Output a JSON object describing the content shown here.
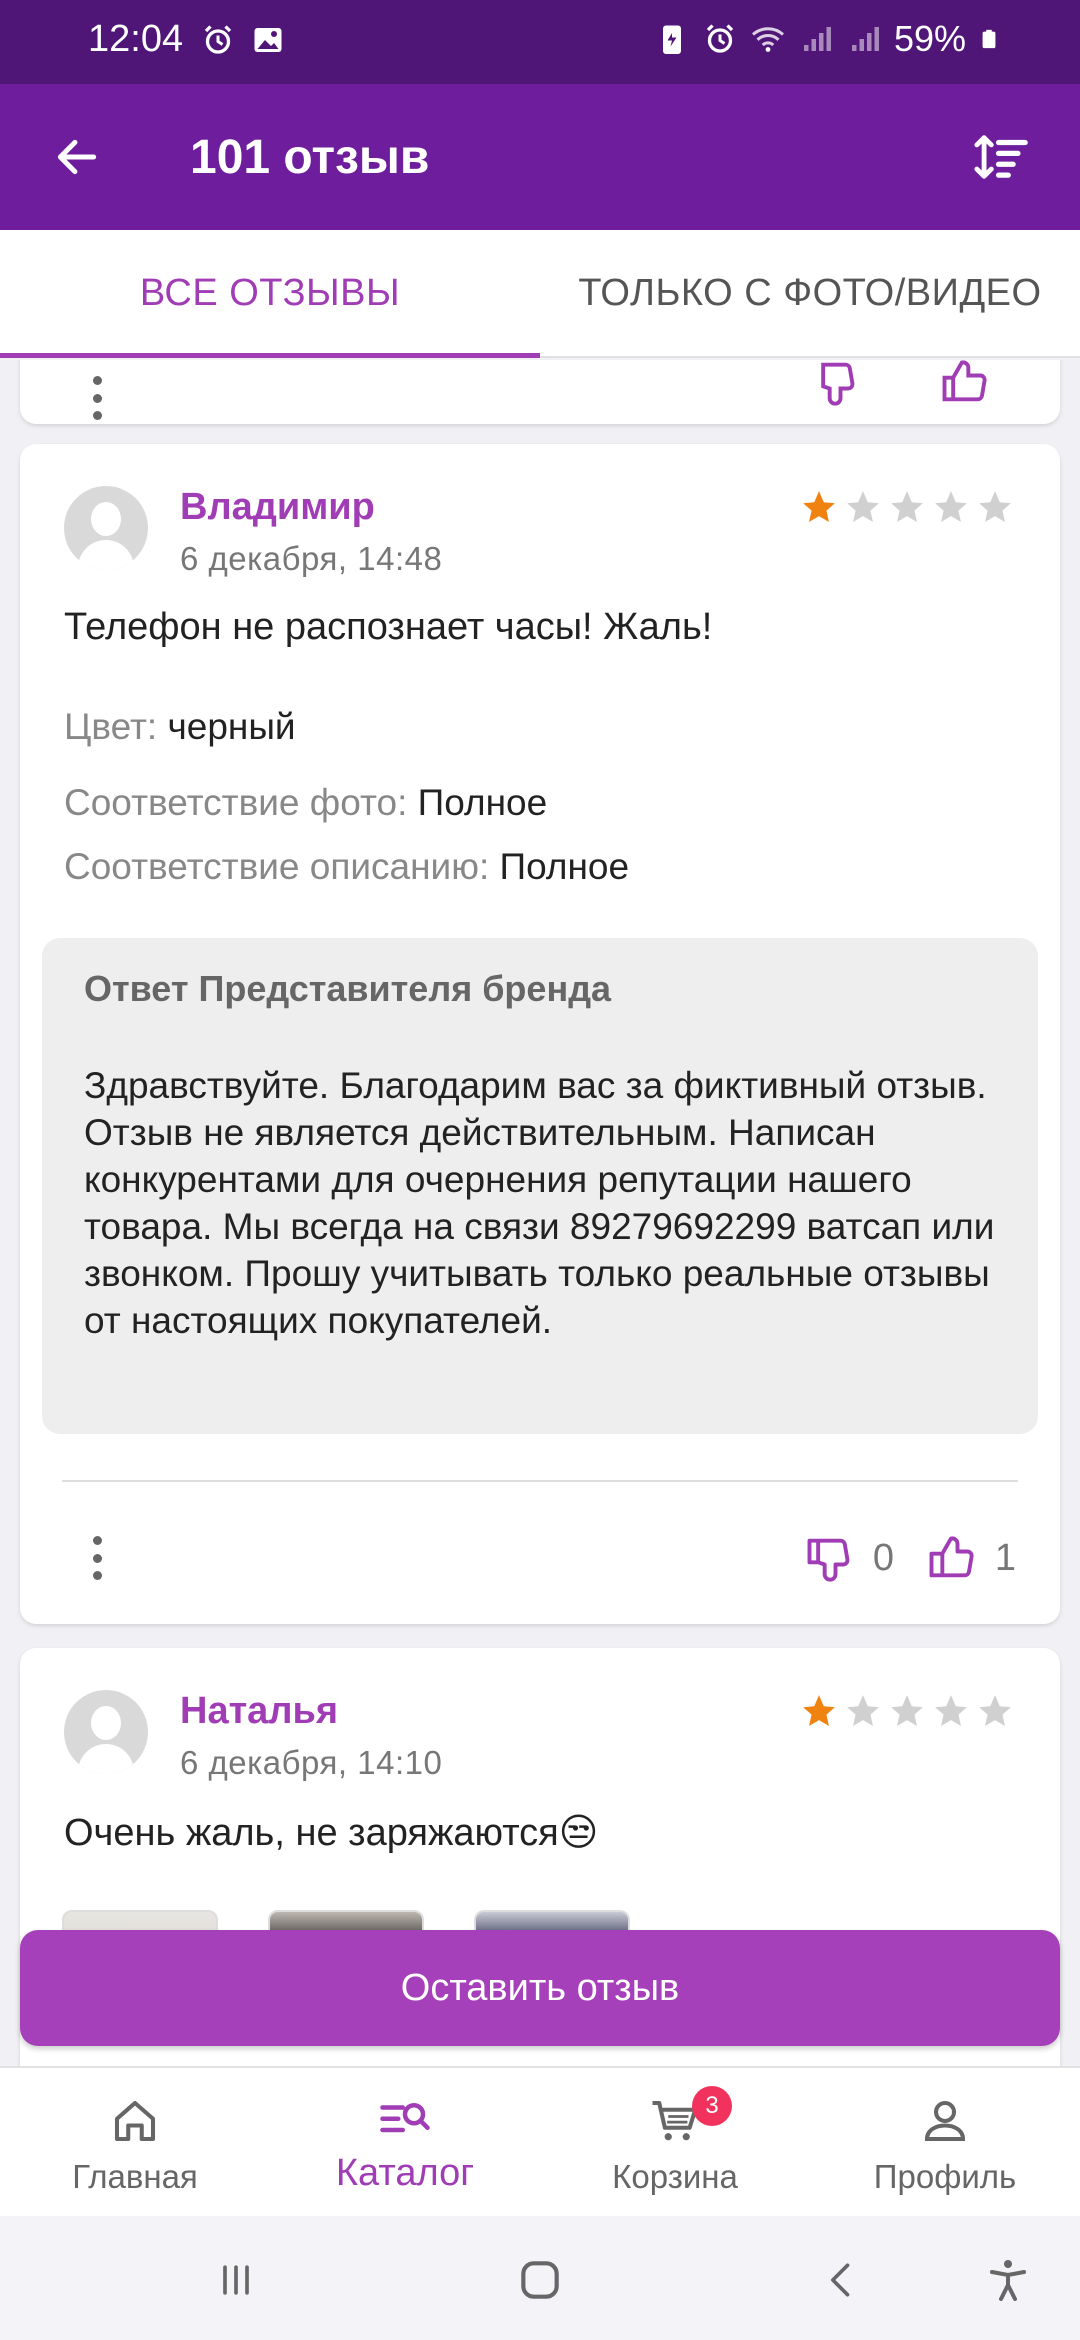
{
  "status_bar": {
    "time": "12:04",
    "battery": "59%"
  },
  "header": {
    "title": "101 отзыв",
    "back_icon": "arrow-back-icon",
    "sort_icon": "sort-icon"
  },
  "tabs": [
    {
      "label": "ВСЕ ОТЗЫВЫ",
      "active": true
    },
    {
      "label": "ТОЛЬКО С ФОТО/ВИДЕО",
      "active": false
    }
  ],
  "reviews": [
    {
      "author": "Владимир",
      "date": "6 декабря, 14:48",
      "rating": 1,
      "text": "Телефон не распознает часы! Жаль!",
      "attributes": [
        {
          "label": "Цвет:",
          "value": "черный"
        },
        {
          "label": "Соответствие фото:",
          "value": "Полное"
        },
        {
          "label": "Соответствие описанию:",
          "value": "Полное"
        }
      ],
      "reply": {
        "title": "Ответ Представителя бренда",
        "text": "Здравствуйте. Благодарим вас за фиктивный отзыв. Отзыв не является действительным. Написан конкурентами для очернения репутации нашего товара. Мы всегда на связи 89279692299 ватсап или звонком. Прошу учитывать только реальные отзывы от настоящих покупателей."
      },
      "dislikes": "0",
      "likes": "1"
    },
    {
      "author": "Наталья",
      "date": "6 декабря, 14:10",
      "rating": 1,
      "text": "Очень жаль, не заряжаются😒"
    }
  ],
  "leave_review_button": "Оставить отзыв",
  "bottom_nav": [
    {
      "label": "Главная",
      "icon": "home-icon"
    },
    {
      "label": "Каталог",
      "icon": "catalog-search-icon",
      "active": true
    },
    {
      "label": "Корзина",
      "icon": "cart-icon",
      "badge": "3"
    },
    {
      "label": "Профиль",
      "icon": "profile-icon"
    }
  ],
  "colors": {
    "primary": "#6e1d9c",
    "accent": "#a03db5",
    "button": "#a540ba",
    "star": "#f0820f",
    "badge": "#f0325c"
  }
}
